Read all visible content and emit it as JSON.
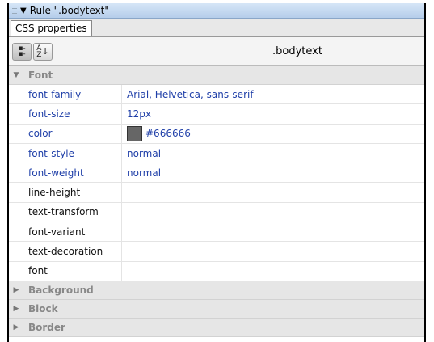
{
  "title_bar": {
    "label": "Rule \".bodytext\""
  },
  "tabs": [
    {
      "label": "CSS properties"
    }
  ],
  "toolbar": {
    "rule_name": ".bodytext"
  },
  "categories": {
    "font": {
      "label": "Font",
      "expanded": true
    },
    "background": {
      "label": "Background",
      "expanded": false
    },
    "block": {
      "label": "Block",
      "expanded": false
    },
    "border": {
      "label": "Border",
      "expanded": false
    }
  },
  "font_properties": [
    {
      "name": "font-family",
      "value": "Arial, Helvetica, sans-serif"
    },
    {
      "name": "font-size",
      "value": "12px"
    },
    {
      "name": "color",
      "value": "#666666",
      "swatch": "#666666"
    },
    {
      "name": "font-style",
      "value": "normal"
    },
    {
      "name": "font-weight",
      "value": "normal"
    },
    {
      "name": "line-height",
      "value": ""
    },
    {
      "name": "text-transform",
      "value": ""
    },
    {
      "name": "font-variant",
      "value": ""
    },
    {
      "name": "text-decoration",
      "value": ""
    },
    {
      "name": "font",
      "value": ""
    }
  ],
  "colors": {
    "set_property": "#1f3fa8",
    "title_bar": "#c6daf1"
  }
}
